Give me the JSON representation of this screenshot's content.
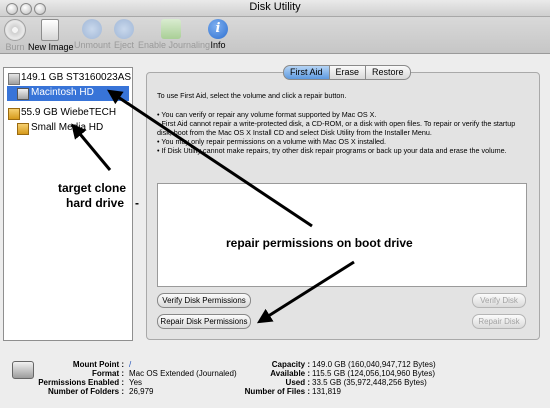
{
  "window": {
    "title": "Disk Utility"
  },
  "toolbar": {
    "burn": "Burn",
    "new_image": "New Image",
    "unmount": "Unmount",
    "eject": "Eject",
    "enable_journaling": "Enable Journaling",
    "info": "Info"
  },
  "sidebar": {
    "items": [
      {
        "label": "149.1 GB ST3160023AS"
      },
      {
        "label": "Macintosh HD"
      },
      {
        "label": "55.9 GB WiebeTECH"
      },
      {
        "label": "Small Media HD"
      }
    ]
  },
  "tabs": {
    "first_aid": "First Aid",
    "erase": "Erase",
    "restore": "Restore"
  },
  "first_aid": {
    "intro": "To use First Aid, select the volume and click a repair button.",
    "b1": "• You can verify or repair any volume format supported by Mac OS X.",
    "b2": "• First Aid cannot repair a write-protected disk, a CD-ROM, or a disk with open files. To repair or verify the startup disk, boot from the Mac OS X Install CD and select Disk Utility from the Installer Menu.",
    "b3": "• You may only repair permissions on a volume with Mac OS X installed.",
    "b4": "• If Disk Utility cannot make repairs, try other disk repair programs or back up your data and erase the volume.",
    "verify_permissions": "Verify Disk Permissions",
    "repair_permissions": "Repair Disk Permissions",
    "verify_disk": "Verify Disk",
    "repair_disk": "Repair Disk"
  },
  "info": {
    "mount_point_label": "Mount Point :",
    "mount_point": "/",
    "format_label": "Format :",
    "format": "Mac OS Extended (Journaled)",
    "perms_label": "Permissions Enabled :",
    "perms": "Yes",
    "folders_label": "Number of Folders :",
    "folders": "26,979",
    "capacity_label": "Capacity :",
    "capacity": "149.0 GB (160,040,947,712 Bytes)",
    "available_label": "Available :",
    "available": "115.5 GB (124,056,104,960 Bytes)",
    "used_label": "Used :",
    "used": "33.5 GB (35,972,448,256 Bytes)",
    "files_label": "Number of Files :",
    "files": "131,819"
  },
  "annotations": {
    "target_clone": "target clone",
    "hard_drive": "hard drive",
    "dash": "-",
    "repair_note": "repair permissions on boot drive"
  },
  "colors": {
    "selection": "#3874d8",
    "toolbar_info": "#2d6fd0"
  }
}
